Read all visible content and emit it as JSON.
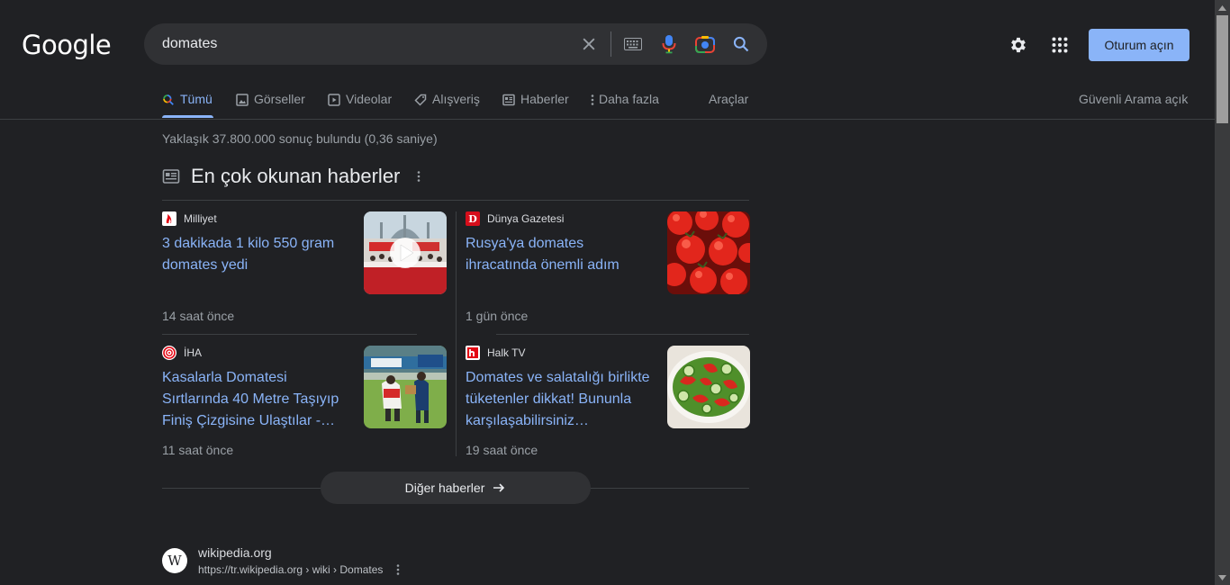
{
  "brand": {
    "logo_text": "Google"
  },
  "search": {
    "query": "domates"
  },
  "header": {
    "signin_label": "Oturum açın"
  },
  "tabs": [
    {
      "label": "Tümü",
      "icon": "search-icon",
      "active": true
    },
    {
      "label": "Görseller",
      "icon": "image-icon"
    },
    {
      "label": "Videolar",
      "icon": "video-icon"
    },
    {
      "label": "Alışveriş",
      "icon": "tag-icon"
    },
    {
      "label": "Haberler",
      "icon": "news-icon"
    },
    {
      "label": "Daha fazla",
      "icon": "more-vert-icon"
    }
  ],
  "tools_label": "Araçlar",
  "safe_search_label": "Güvenli Arama açık",
  "result_stats": "Yaklaşık 37.800.000 sonuç bulundu (0,36 saniye)",
  "news": {
    "title": "En çok okunan haberler",
    "items": [
      {
        "source": "Milliyet",
        "headline": "3 dakikada 1 kilo 550 gram domates yedi",
        "time": "14 saat önce"
      },
      {
        "source": "Dünya Gazetesi",
        "headline": "Rusya'ya domates ihracatında önemli adım",
        "time": "1 gün önce"
      },
      {
        "source": "İHA",
        "headline": "Kasalarla Domatesi Sırtlarında 40 Metre Taşıyıp Finiş Çizgisine Ulaştılar -…",
        "time": "11 saat önce"
      },
      {
        "source": "Halk TV",
        "headline": "Domates ve salatalığı birlikte tüketenler dikkat! Bununla karşılaşabilirsiniz…",
        "time": "19 saat önce"
      }
    ],
    "more_label": "Diğer haberler"
  },
  "result": {
    "site": "wikipedia.org",
    "url": "https://tr.wikipedia.org › wiki › Domates",
    "favicon_letter": "W"
  },
  "colors": {
    "accent": "#8ab4f8",
    "background": "#202124",
    "surface": "#303134"
  }
}
